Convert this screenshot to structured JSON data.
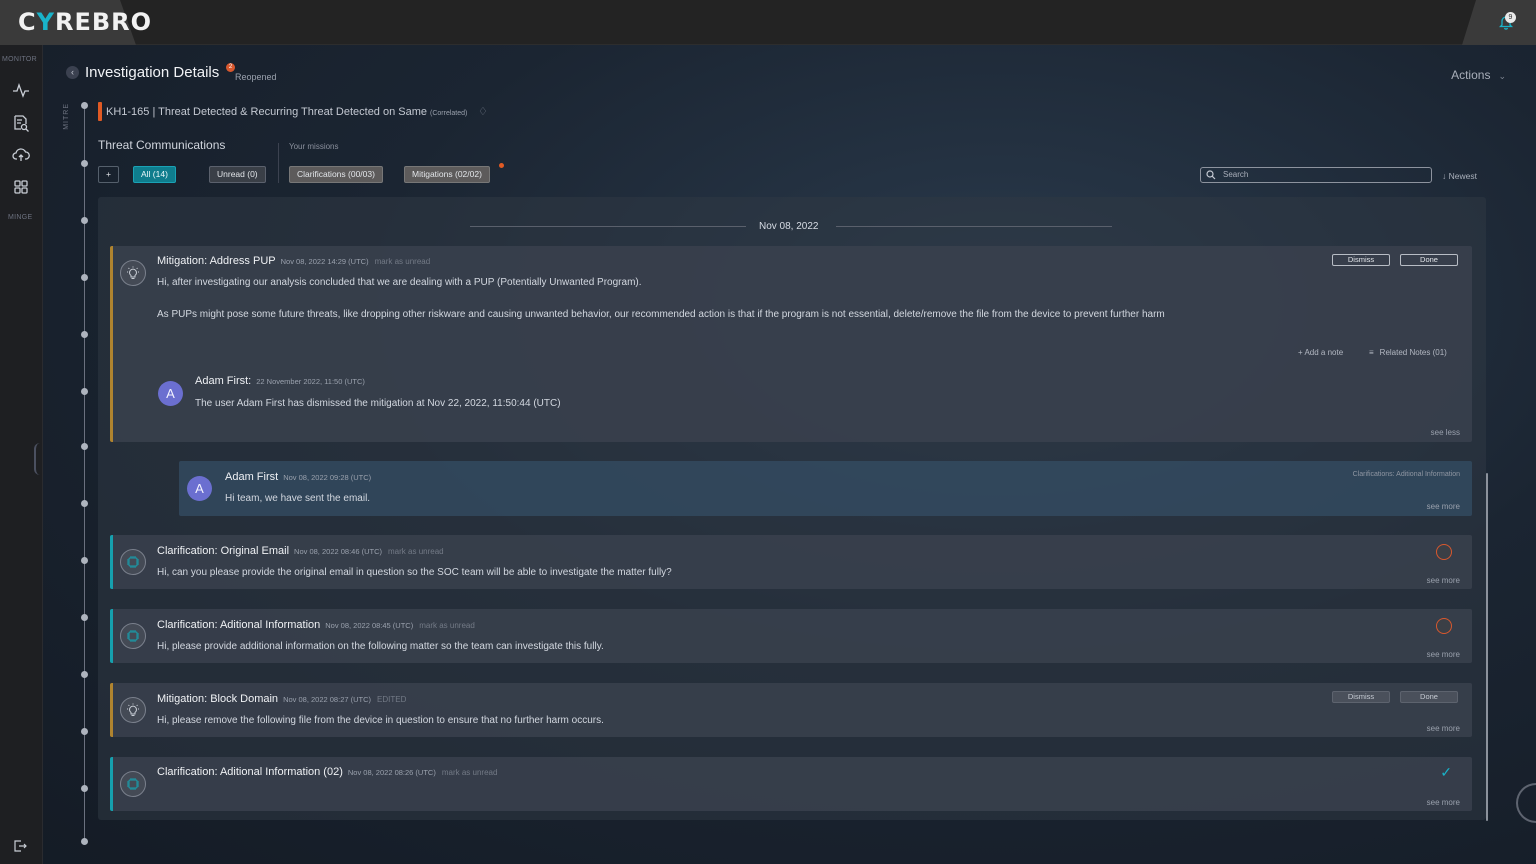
{
  "app": {
    "logo_pre": "C",
    "logo_y": "Y",
    "logo_post": "REBRO",
    "notif_count": "9"
  },
  "sidebar": {
    "monitor_label": "MONITOR",
    "minge_label": "MINGE"
  },
  "header": {
    "title": "Investigation Details",
    "badge": "2",
    "status": "Reopened",
    "actions_label": "Actions"
  },
  "case": {
    "title": "KH1-165 | Threat Detected & Recurring Threat Detected on Same",
    "correlated": "(Correlated)",
    "mitre_label": "MITRE"
  },
  "filters": {
    "section_title": "Threat Communications",
    "missions_label": "Your missions",
    "plus": "+",
    "all": "All (14)",
    "unread": "Unread (0)",
    "clarifications": "Clarifications (00/03)",
    "mitigations": "Mitigations (02/02)",
    "search_placeholder": "Search",
    "sort": "↓ Newest"
  },
  "feed": {
    "date": "Nov 08, 2022",
    "cards": [
      {
        "title": "Mitigation: Address PUP",
        "meta": "Nov 08, 2022 14:29 (UTC)",
        "mark": "mark as unread",
        "body1": "Hi, after investigating our analysis concluded that we are dealing with a PUP (Potentially Unwanted Program).",
        "body2": "As PUPs might pose some future threats, like dropping other riskware and causing unwanted behavior, our recommended action is that if the program is not essential, delete/remove the file from the device to prevent further harm",
        "dismiss": "Dismiss",
        "done": "Done",
        "add_note": "+ Add a note",
        "related_notes": "Related Notes (01)",
        "note_avatar": "A",
        "note_author": "Adam First:",
        "note_meta": "22 November 2022, 11:50 (UTC)",
        "note_text": "The user Adam First has dismissed the mitigation at Nov 22, 2022, 11:50:44 (UTC)",
        "see": "see less"
      },
      {
        "avatar": "A",
        "author": "Adam First",
        "meta": "Nov 08, 2022 09:28 (UTC)",
        "context": "Clarifications: Aditional Information",
        "text": "Hi team, we have sent the email.",
        "see": "see more"
      },
      {
        "title": "Clarification: Original Email",
        "meta": "Nov 08, 2022 08:46 (UTC)",
        "mark": "mark as unread",
        "body": "Hi, can you please provide the original email in question so the SOC team will be able to investigate the matter fully?",
        "see": "see more"
      },
      {
        "title": "Clarification: Aditional Information",
        "meta": "Nov 08, 2022 08:45 (UTC)",
        "mark": "mark as unread",
        "body": "Hi, please provide additional information on the following matter so the team can investigate this fully.",
        "see": "see more"
      },
      {
        "title": "Mitigation: Block Domain",
        "meta": "Nov 08, 2022 08:27 (UTC)",
        "mark": "EDITED",
        "body": "Hi, please remove the following file from the device in question to ensure that no further harm occurs.",
        "dismiss": "Dismiss",
        "done": "Done",
        "see": "see more"
      },
      {
        "title": "Clarification: Aditional Information (02)",
        "meta": "Nov 08, 2022 08:26 (UTC)",
        "mark": "mark as unread",
        "see": "see more"
      }
    ]
  },
  "colors": {
    "accent": "#19b3c9",
    "mitigation": "#b0842f",
    "clarification": "#16a0ae",
    "alert": "#e05a24"
  },
  "icons": [
    "bell-icon",
    "activity-icon",
    "search-document-icon",
    "cloud-upload-icon",
    "grid-icon",
    "logout-icon",
    "back-chevron-icon",
    "chevron-down-icon",
    "lightbulb-icon",
    "chip-icon",
    "search-icon",
    "list-icon",
    "cancel-circle-icon",
    "check-icon"
  ]
}
